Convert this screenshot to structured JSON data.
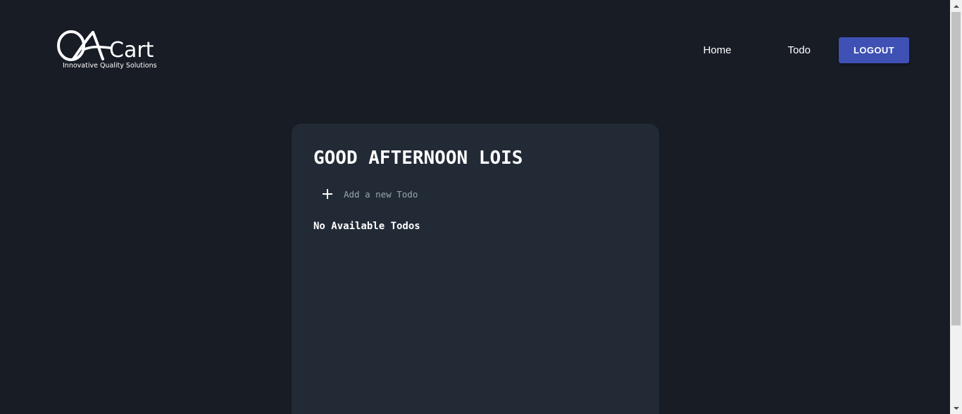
{
  "header": {
    "logo_word": "Cart",
    "logo_tagline": "Innovative Quality Solutions",
    "nav": {
      "home": "Home",
      "todo": "Todo",
      "logout": "LOGOUT"
    }
  },
  "main": {
    "greeting": "GOOD AFTERNOON LOIS",
    "add_todo_placeholder": "Add a new Todo",
    "empty_message": "No Available Todos"
  },
  "icons": {
    "logo": "qa-cart-logo",
    "add": "plus-icon",
    "scroll_up": "chevron-up-icon",
    "scroll_down": "chevron-down-icon"
  },
  "colors": {
    "background": "#171c25",
    "card": "#222a35",
    "accent": "#3f51b5",
    "muted_text": "#9aa4b2"
  }
}
